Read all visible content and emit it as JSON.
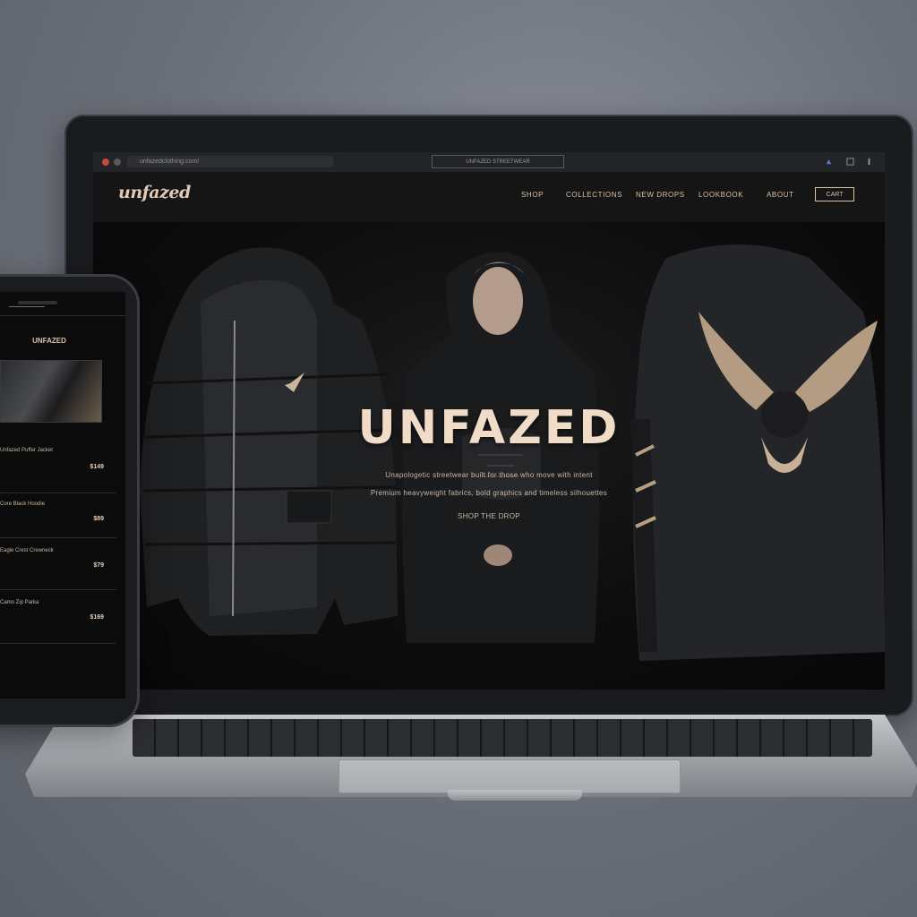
{
  "browser": {
    "url": "unfazedclothing.com/",
    "tab_title": "UNFAZED STREETWEAR"
  },
  "site": {
    "logo": "unfazed",
    "nav": [
      "SHOP",
      "COLLECTIONS",
      "NEW DROPS",
      "LOOKBOOK",
      "ABOUT"
    ],
    "cart_button": "CART"
  },
  "hero": {
    "title": "UNFAZED",
    "lines": [
      "Unapologetic streetwear built for those who move with intent",
      "Premium heavyweight fabrics, bold graphics and timeless silhouettes",
      "SHOP THE DROP"
    ]
  },
  "phone": {
    "title": "UNFAZED",
    "items": [
      {
        "name": "Unfazed Puffer Jacket",
        "price": "$149"
      },
      {
        "name": "Core Black Hoodie",
        "price": "$89"
      },
      {
        "name": "Eagle Crest Crewneck",
        "price": "$79"
      },
      {
        "name": "Camo Zip Parka",
        "price": "$169"
      }
    ]
  },
  "colors": {
    "accent": "#e0cbb4",
    "background": "#0b0b0c",
    "desk": "#6e727b"
  }
}
